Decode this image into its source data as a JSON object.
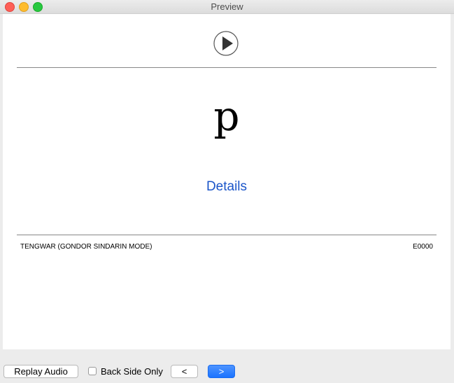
{
  "window": {
    "title": "Preview"
  },
  "card": {
    "glyph": "p",
    "details_link": "Details",
    "deck_name": "TENGWAR (GONDOR SINDARIN MODE)",
    "card_code": "E0000"
  },
  "controls": {
    "replay_audio": "Replay Audio",
    "back_side_only": "Back Side Only",
    "back_side_only_checked": false,
    "prev_label": "<",
    "next_label": ">"
  },
  "colors": {
    "accent": "#1a55c9",
    "primary_button": "#1a73ff"
  }
}
